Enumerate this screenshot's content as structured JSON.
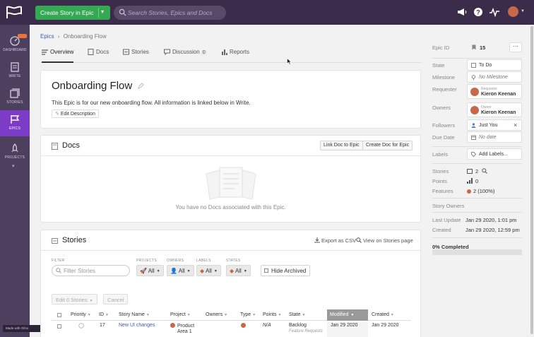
{
  "topbar": {
    "create_button": "Create Story in Epic",
    "search_placeholder": "Search Stories, Epics and Docs"
  },
  "nav": {
    "items": [
      {
        "label": "DASHBOARD",
        "icon": "dashboard-icon"
      },
      {
        "label": "WRITE",
        "icon": "write-icon"
      },
      {
        "label": "STORIES",
        "icon": "stories-icon"
      },
      {
        "label": "EPICS",
        "icon": "epics-flag-icon"
      },
      {
        "label": "PROJECTS",
        "icon": "rocket-icon"
      }
    ],
    "made_with": "Made with Gifox"
  },
  "breadcrumb": {
    "root": "Epics",
    "separator": "›",
    "current": "Onboarding Flow"
  },
  "tabs": [
    {
      "label": "Overview"
    },
    {
      "label": "Docs"
    },
    {
      "label": "Stories"
    },
    {
      "label": "Discussion",
      "count": "0"
    },
    {
      "label": "Reports"
    }
  ],
  "epic": {
    "title": "Onboarding Flow",
    "description": "This Epic is for our new onboarding flow. All information is linked below in Write.",
    "edit_button": "Edit Description"
  },
  "docs": {
    "title": "Docs",
    "link_button": "Link Doc to Epic",
    "create_button": "Create Doc for Epic",
    "empty_text": "You have no Docs associated with this Epic."
  },
  "stories": {
    "title": "Stories",
    "export": "Export as CSV",
    "view_link": "View on Stories page",
    "filter_label": "FILTER",
    "filter_placeholder": "Filter Stories",
    "filters": [
      {
        "label": "PROJECTS",
        "value": "All"
      },
      {
        "label": "OWNERS",
        "value": "All"
      },
      {
        "label": "LABELS",
        "value": "All"
      },
      {
        "label": "STATES",
        "value": "All"
      }
    ],
    "hide_archived": "Hide Archived",
    "edit_button": "Edit 0 Stories",
    "cancel_button": "Cancel",
    "columns": [
      "Priority",
      "ID",
      "Story Name",
      "Project",
      "Owners",
      "Type",
      "Points",
      "State",
      "Modified",
      "Created"
    ],
    "rows": [
      {
        "id": "17",
        "name": "New UI changes",
        "project_line1": "Product",
        "project_line2": "Area 1",
        "points": "N/A",
        "state": "Backlog",
        "state_sub": "Feature Requests",
        "modified": "Jan 29 2020",
        "created": "Jan 29 2020"
      }
    ]
  },
  "sidebar": {
    "epic_id_label": "Epic ID",
    "epic_id": "15",
    "more_button": "···",
    "state_label": "State",
    "state": "To Do",
    "milestone_label": "Milestone",
    "milestone": "No Milestone",
    "requester_label": "Requester",
    "requester_role": "Requester",
    "requester": "Kieron Keenan",
    "owners_label": "Owners",
    "owner_role": "Owner",
    "owner": "Kieron Keenan",
    "followers_label": "Followers",
    "follower": "Just You",
    "follower_remove": "×",
    "due_label": "Due Date",
    "due": "No date",
    "labels_label": "Labels",
    "labels_button": "Add Labels...",
    "stories_label": "Stories",
    "stories_count": "2",
    "points_label": "Points",
    "points": "0",
    "features_label": "Features",
    "features": "2",
    "features_pct": "(100%)",
    "story_owners_label": "Story Owners",
    "last_update_label": "Last Update",
    "last_update": "Jan 29 2020, 1:01 pm",
    "created_label": "Created",
    "created": "Jan 29 2020, 12:59 pm",
    "percent_label": "0% Completed",
    "percent_value": 0
  },
  "colors": {
    "topbar": "#3a2c4a",
    "nav": "#4d3f5e",
    "nav_active": "#7d3cc8",
    "create_button": "#34a853",
    "link": "#3f58b5",
    "feature_dot": "#c8684a"
  }
}
